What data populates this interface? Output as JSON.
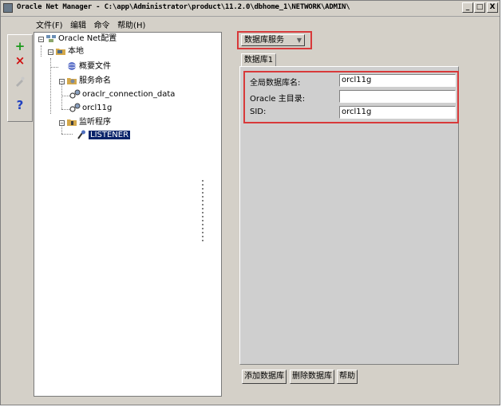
{
  "window": {
    "title": "Oracle Net Manager - C:\\app\\Administrator\\product\\11.2.0\\dbhome_1\\NETWORK\\ADMIN\\",
    "controls": [
      "_",
      "□",
      "X"
    ]
  },
  "menu": {
    "items": [
      "文件(F)",
      "编辑",
      "命令",
      "帮助(H)"
    ]
  },
  "toolbar": {
    "add": "+",
    "remove": "×",
    "help": "?"
  },
  "tree": {
    "root": "Oracle Net配置",
    "local": "本地",
    "profile": "概要文件",
    "service_naming": "服务命名",
    "service1": "oraclr_connection_data",
    "service2": "orcl11g",
    "listeners": "监听程序",
    "listener": "LISTENER"
  },
  "panel": {
    "dropdown_value": "数据库服务",
    "tab_label": "数据库1",
    "fields": [
      {
        "label": "全局数据库名:",
        "value": "orcl11g"
      },
      {
        "label": "Oracle 主目录:",
        "value": ""
      },
      {
        "label": "SID:",
        "value": "orcl11g"
      }
    ]
  },
  "buttons": {
    "add_db": "添加数据库",
    "remove_db": "删除数据库",
    "help": "帮助"
  },
  "colors": {
    "highlight_border": "#d8393a",
    "selection": "#0a246a",
    "window_bg": "#d4d0c8"
  }
}
